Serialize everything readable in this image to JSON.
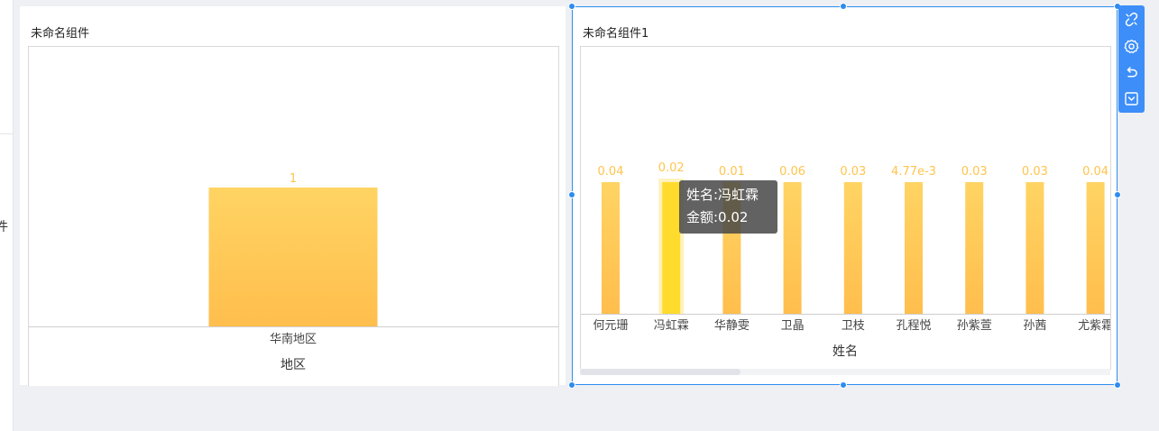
{
  "left_edge": {
    "glyph": "件"
  },
  "widgets": [
    {
      "title": "未命名组件",
      "chart_data": {
        "type": "bar",
        "categories": [
          "华南地区"
        ],
        "values": [
          1
        ],
        "value_labels": [
          "1"
        ],
        "xlabel": "地区",
        "ylabel": "",
        "ylim": [
          0,
          1
        ]
      }
    },
    {
      "title": "未命名组件1",
      "chart_data": {
        "type": "bar",
        "categories": [
          "何元珊",
          "冯虹霖",
          "华静雯",
          "卫晶",
          "卫枝",
          "孔程悦",
          "孙紫萱",
          "孙茜",
          "尤紫霜"
        ],
        "values": [
          0.04,
          0.02,
          0.01,
          0.06,
          0.03,
          0.00477,
          0.03,
          0.03,
          0.04
        ],
        "value_labels": [
          "0.04",
          "0.02",
          "0.01",
          "0.06",
          "0.03",
          "4.77e-3",
          "0.03",
          "0.03",
          "0.04"
        ],
        "xlabel": "姓名",
        "ylabel": "",
        "highlighted_index": 1
      }
    }
  ],
  "tooltip": {
    "line1": "姓名:冯虹霖",
    "line2": "金额:0.02"
  },
  "toolbar": {
    "items": [
      {
        "icon": "unlink-icon"
      },
      {
        "icon": "settings-icon"
      },
      {
        "icon": "undo-icon"
      },
      {
        "icon": "collapse-icon"
      }
    ]
  },
  "colors": {
    "bar_top": "#ffd463",
    "bar_bottom": "#ffbe4d",
    "bar_highlight": "#ffdb2e",
    "label": "#ffc44d",
    "accent": "#3d8ef8"
  }
}
